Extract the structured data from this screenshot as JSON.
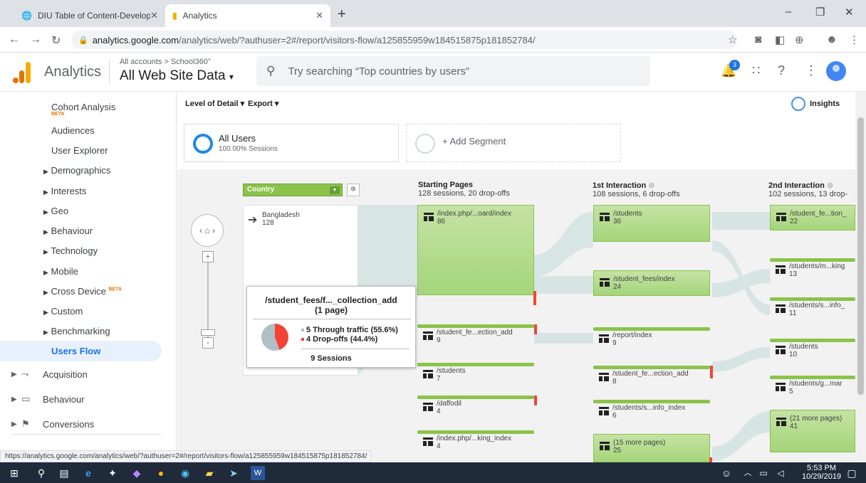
{
  "browser": {
    "tabs": [
      {
        "title": "DIU Table of Content-Developme"
      },
      {
        "title": "Analytics"
      }
    ],
    "url_host": "analytics.google.com",
    "url_path": "/analytics/web/?authuser=2#/report/visitors-flow/a125855959w184515875p181852784/",
    "status_url": "https://analytics.google.com/analytics/web/?authuser=2#/report/visitors-flow/a125855959w184515875p181852784/"
  },
  "header": {
    "app_name": "Analytics",
    "breadcrumb": "All accounts > School360°",
    "view_name": "All Web Site Data",
    "search_placeholder": "Try searching “Top countries by users”",
    "notification_count": "3"
  },
  "sidebar": {
    "items": [
      {
        "label": "Cohort Analysis",
        "badge": "BETA"
      },
      {
        "label": "Audiences"
      },
      {
        "label": "User Explorer"
      },
      {
        "label": "Demographics"
      },
      {
        "label": "Interests"
      },
      {
        "label": "Geo"
      },
      {
        "label": "Behaviour"
      },
      {
        "label": "Technology"
      },
      {
        "label": "Mobile"
      },
      {
        "label": "Cross Device",
        "badge": "BETA"
      },
      {
        "label": "Custom"
      },
      {
        "label": "Benchmarking"
      }
    ],
    "active": "Users Flow",
    "sections": [
      {
        "label": "Acquisition"
      },
      {
        "label": "Behaviour"
      },
      {
        "label": "Conversions"
      }
    ]
  },
  "toolbar": {
    "level_of_detail": "Level of Detail",
    "export": "Export",
    "insights": "Insights"
  },
  "segments": {
    "all_users": "All Users",
    "all_users_sub": "100.00% Sessions",
    "add_segment": "+ Add Segment"
  },
  "flow": {
    "dimension": "Country",
    "country": {
      "name": "Bangladesh",
      "count": "128"
    },
    "columns": [
      {
        "name": "Starting Pages",
        "stats": "128 sessions, 20 drop-offs"
      },
      {
        "name": "1st Interaction",
        "stats": "108 sessions, 6 drop-offs"
      },
      {
        "name": "2nd Interaction",
        "stats": "102 sessions, 13 drop-"
      }
    ],
    "starting_pages": [
      {
        "page": "/index.php/...oard/index",
        "count": "86"
      },
      {
        "page": "/student_fe...ection_add",
        "count": "9"
      },
      {
        "page": "/students",
        "count": "7"
      },
      {
        "page": "/daffodil",
        "count": "4"
      },
      {
        "page": "/index.php/...king_index",
        "count": "4"
      }
    ],
    "first_interaction": [
      {
        "page": "/students",
        "count": "36"
      },
      {
        "page": "/student_fees/index",
        "count": "24"
      },
      {
        "page": "/report/index",
        "count": "9"
      },
      {
        "page": "/student_fe...ection_add",
        "count": "8"
      },
      {
        "page": "/students/s...info_index",
        "count": "6"
      },
      {
        "page": "(15 more pages)",
        "count": "25"
      }
    ],
    "second_interaction": [
      {
        "page": "/student_fe...tion_",
        "count": "22"
      },
      {
        "page": "/students/m...king",
        "count": "13"
      },
      {
        "page": "/students/s...info_",
        "count": "11"
      },
      {
        "page": "/students",
        "count": "10"
      },
      {
        "page": "/students/g...mar",
        "count": "5"
      },
      {
        "page": "(21 more pages)",
        "count": "41"
      }
    ],
    "tooltip": {
      "title": "/student_fees/f..._collection_add",
      "subtitle": "(1 page)",
      "through": "5  Through traffic (55.6%)",
      "dropoffs": "4  Drop-offs (44.4%)",
      "sessions": "9  Sessions",
      "through_pct": 55.6,
      "dropoff_pct": 44.4
    }
  },
  "taskbar": {
    "time": "5:53 PM",
    "date": "10/29/2019"
  },
  "colors": {
    "node_green": "#a4d57a",
    "dropoff_red": "#f44336",
    "active_blue": "#1a73e8"
  }
}
